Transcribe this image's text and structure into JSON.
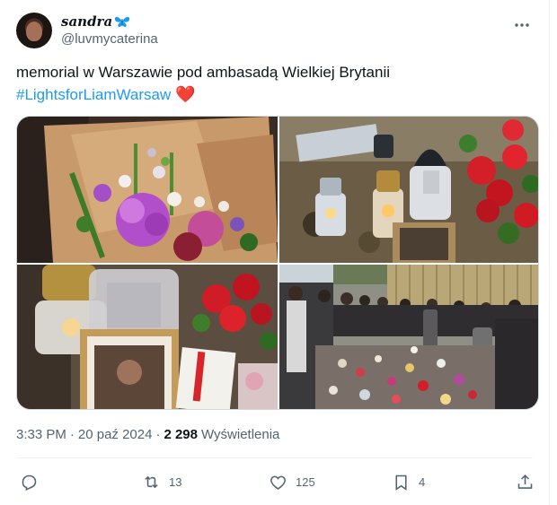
{
  "tweet": {
    "display_name": "sandra",
    "handle": "@luvmycaterina",
    "text_line1": "memorial w Warszawie pod ambasadą Wielkiej Brytanii",
    "hashtag": "#LightsforLiamWarsaw",
    "heart_emoji": "❤️",
    "more_icon": "more-horizontal-icon",
    "time": "3:33 PM",
    "separator": "·",
    "date": "20 paź 2024",
    "views_count": "2 298",
    "views_label": "Wyświetlenia"
  },
  "media": {
    "images": [
      {
        "description_name": "flower-bouquet-photo"
      },
      {
        "description_name": "candles-and-roses-photo"
      },
      {
        "description_name": "lantern-and-framed-photo"
      },
      {
        "description_name": "crowd-at-memorial-photo"
      }
    ]
  },
  "actions": {
    "reply": {
      "icon": "reply-icon",
      "count": ""
    },
    "retweet": {
      "icon": "retweet-icon",
      "count": "13"
    },
    "like": {
      "icon": "heart-icon",
      "count": "125"
    },
    "bookmark": {
      "icon": "bookmark-icon",
      "count": "4"
    },
    "share": {
      "icon": "share-icon",
      "count": ""
    }
  },
  "colors": {
    "accent": "#1d9bf0",
    "text_primary": "#0f1419",
    "text_secondary": "#536471",
    "heart": "#e0245e"
  }
}
